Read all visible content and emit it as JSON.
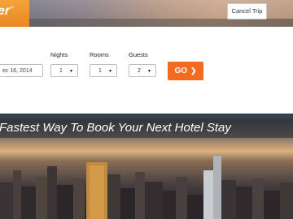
{
  "header": {
    "logo_text": "er",
    "logo_tm": "™",
    "cancel_label": "Cancel Trip"
  },
  "form": {
    "date_value": "ec 16, 2014",
    "nights_label": "Nights",
    "nights_value": "1",
    "rooms_label": "Rooms",
    "rooms_value": "1",
    "guests_label": "Guests",
    "guests_value": "2",
    "go_label": "GO",
    "caret_glyph": "▼",
    "go_arrow_glyph": "❯"
  },
  "banner": {
    "tagline": "Fastest Way To Book Your Next Hotel Stay"
  },
  "colors": {
    "accent": "#f26b1f",
    "logo_orange": "#e9861f"
  }
}
